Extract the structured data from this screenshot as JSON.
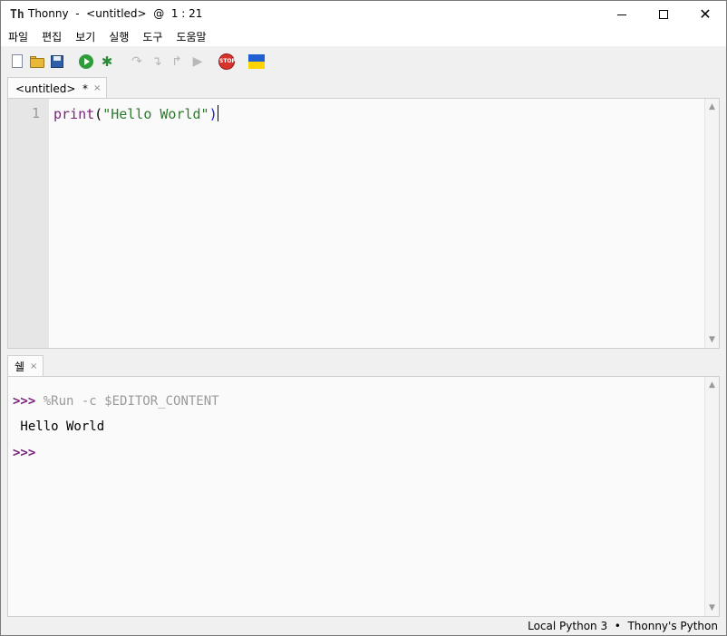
{
  "window": {
    "title": "Thonny  -  <untitled>  @  1 : 21",
    "app_icon": "Th"
  },
  "menu": {
    "items": [
      "파일",
      "편집",
      "보기",
      "실행",
      "도구",
      "도움말"
    ]
  },
  "toolbar": {
    "icons": [
      "new-file-icon",
      "open-file-icon",
      "save-icon",
      "run-icon",
      "debug-icon",
      "step-over-icon",
      "step-into-icon",
      "step-out-icon",
      "resume-icon",
      "stop-icon",
      "ukraine-flag-icon"
    ],
    "stop_text": "STOP"
  },
  "editor": {
    "tab_label": "<untitled>  *",
    "tab_close": "×",
    "line_numbers": [
      "1"
    ],
    "code": {
      "func": "print",
      "open": "(",
      "string": "\"Hello World\"",
      "close": ")"
    }
  },
  "shell": {
    "tab_label": "쉘",
    "tab_close": "×",
    "prompt": ">>>",
    "command": " %Run -c $EDITOR_CONTENT",
    "output": " Hello World"
  },
  "status": {
    "text": "Local Python 3  •  Thonny's Python"
  },
  "colors": {
    "keyword": "#7a1f7a",
    "string": "#2b7a2b",
    "bracket_highlight": "#1a1ad6",
    "run_green": "#2f9b3a",
    "stop_red": "#d8322c"
  }
}
